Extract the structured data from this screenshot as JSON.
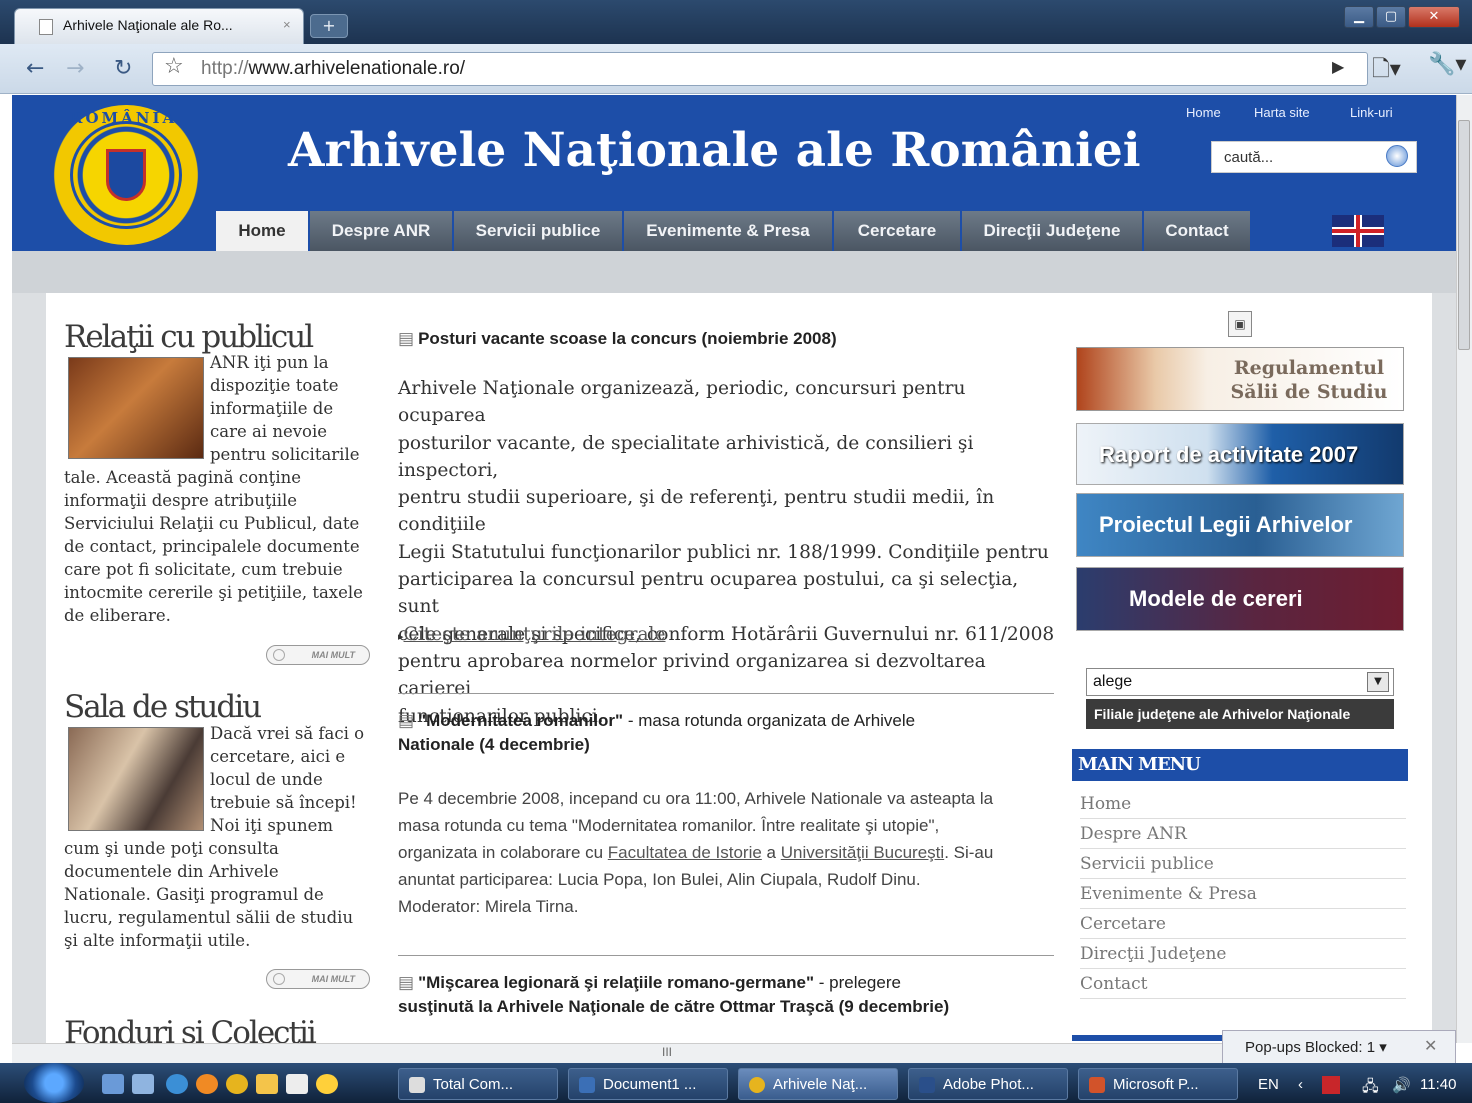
{
  "browser": {
    "tab_title": "Arhivele Naţionale ale Ro...",
    "tab_close": "×",
    "new_tab": "+",
    "window_buttons": {
      "minimize": "▁",
      "maximize": "▢",
      "close": "✕"
    },
    "url_scheme": "http://",
    "url_host": "www.arhivelenationale.ro/",
    "icons": [
      "back-arrow-icon",
      "forward-arrow-icon",
      "reload-icon",
      "star-icon",
      "go-icon",
      "page-menu-icon",
      "wrench-icon"
    ]
  },
  "header": {
    "seal_text": "ROMÂNIA",
    "title": "Arhivele Naţionale ale României",
    "top_links": [
      "Home",
      "Harta site",
      "Link-uri"
    ],
    "search_placeholder": "caută...",
    "nav": [
      "Home",
      "Despre ANR",
      "Servicii publice",
      "Evenimente & Presa",
      "Cercetare",
      "Direcţii Judeţene",
      "Contact"
    ],
    "active_nav": "Home"
  },
  "left": {
    "sections": [
      {
        "title": "Relaţii cu publicul",
        "wrap_lines": [
          "ANR iţi pun la",
          "dispoziţie toate",
          "informaţiile de",
          "care ai nevoie",
          "pentru solicitarile"
        ],
        "full_lines": [
          "tale. Această pagină conţine",
          "informaţii despre atribuţiile",
          "Serviciului Relaţii cu Publicul, date",
          "de contact, principalele documente",
          "care pot fi solicitate, cum trebuie",
          "intocmite cererile şi petiţiile, taxele",
          "de eliberare."
        ],
        "more": "MAI MULT"
      },
      {
        "title": "Sala de studiu",
        "wrap_lines": [
          "Dacă vrei să faci o",
          "cercetare, aici e",
          "locul de unde",
          "trebuie să începi!",
          "Noi iţi spunem"
        ],
        "full_lines": [
          "cum şi unde poţi consulta",
          "documentele din Arhivele",
          "Nationale. Gasiţi programul de",
          "lucru, regulamentul sălii de studiu",
          "şi alte informaţii utile."
        ],
        "more": "MAI MULT"
      },
      {
        "title": "Fonduri si Colectii"
      }
    ]
  },
  "center": {
    "news1": {
      "title": "Posturi vacante scoase la concurs (noiembrie 2008)",
      "lines": [
        "Arhivele Naţionale organizează, periodic, concursuri pentru ocuparea",
        "posturilor vacante, de specialitate arhivistică, de consilieri şi inspectori,",
        "pentru studii superioare, şi de referenţi, pentru studii medii, în condiţiile",
        "Legii Statutului funcţionarilor publici nr. 188/1999. Condiţiile pentru",
        "participarea la concursul pentru ocuparea postului, ca şi selecţia, sunt",
        "cele generale şi specifice, conform Hotărârii Guvernului nr. 611/2008",
        "pentru aprobarea normelor privind organizarea si dezvoltarea carierei",
        "functionarilor publici."
      ],
      "link": "Citeşte anunţurile integrale"
    },
    "news2": {
      "title_bold": "\"Modernitatea romanilor\"",
      "title_rest": " - masa rotunda organizata de Arhivele",
      "title_line2": "Nationale (4 decembrie)",
      "line1": "Pe 4 decembrie 2008, incepand cu ora 11:00, Arhivele Nationale va asteapta la",
      "line2": "masa rotunda cu tema \"Modernitatea romanilor. Între realitate şi utopie\",",
      "line3_pre": "organizata in colaborare cu ",
      "link1": "Facultatea de Istorie",
      "line3_mid": " a ",
      "link2": "Universităţii Bucureşti",
      "line3_post": ". Si-au",
      "line4": "anuntat participarea: Lucia Popa, Ion Bulei, Alin Ciupala, Rudolf Dinu.",
      "line5": "Moderator: Mirela Tirna."
    },
    "news3": {
      "title_bold": "\"Mişcarea legionară şi relaţiile romano-germane\"",
      "title_rest": " - prelegere",
      "title_line2": "susţinută la Arhivele Naţionale de către Ottmar Traşcă (9 decembrie)"
    }
  },
  "right": {
    "banners": [
      "Regulamentul",
      "Sălii de Studiu",
      "Raport de activitate 2007",
      "Proiectul Legii Arhivelor",
      "Modele de cereri"
    ],
    "select_value": "alege",
    "filiale": "Filiale judeţene ale Arhivelor Naţionale",
    "main_menu_title": "MAIN MENU",
    "main_menu": [
      "Home",
      "Despre ANR",
      "Servicii publice",
      "Evenimente & Presa",
      "Cercetare",
      "Direcţii Judeţene",
      "Contact"
    ]
  },
  "popups": {
    "text": "Pop-ups Blocked: 1 ▾",
    "close": "✕"
  },
  "scroll_marker": "III",
  "taskbar": {
    "tasks": [
      "Total Com...",
      "Document1 ...",
      "Arhivele Naţ...",
      "Adobe Phot...",
      "Microsoft P..."
    ],
    "lang": "EN",
    "clock": "11:40"
  },
  "colors": {
    "brand_blue": "#1d4ea8",
    "nav_gray": "#5a6573",
    "menu_header": "#1d4ea8"
  }
}
